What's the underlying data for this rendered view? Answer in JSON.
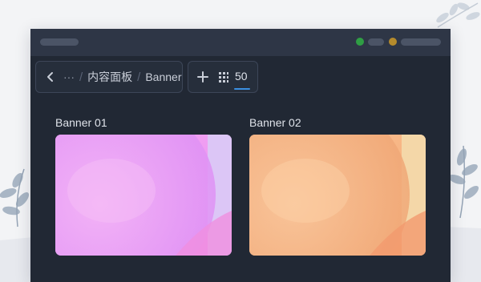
{
  "breadcrumb": {
    "ellipsis": "···",
    "section": "内容面板",
    "current": "Banner"
  },
  "toolbar": {
    "count": "50"
  },
  "banners": [
    {
      "label": "Banner 01",
      "palette": [
        "#f7a8f0",
        "#e69cf7",
        "#d9c2f7"
      ]
    },
    {
      "label": "Banner 02",
      "palette": [
        "#fbc18f",
        "#f4a77a",
        "#f5d6a5"
      ]
    }
  ],
  "colors": {
    "window": "#212834",
    "titlebar": "#2e3646",
    "accent": "#3b8fe0",
    "status_green": "#2f9e44",
    "status_amber": "#b58b2c"
  },
  "icons": [
    "back-chevron-icon",
    "add-icon",
    "grid-icon",
    "leaf-decoration-icon"
  ]
}
